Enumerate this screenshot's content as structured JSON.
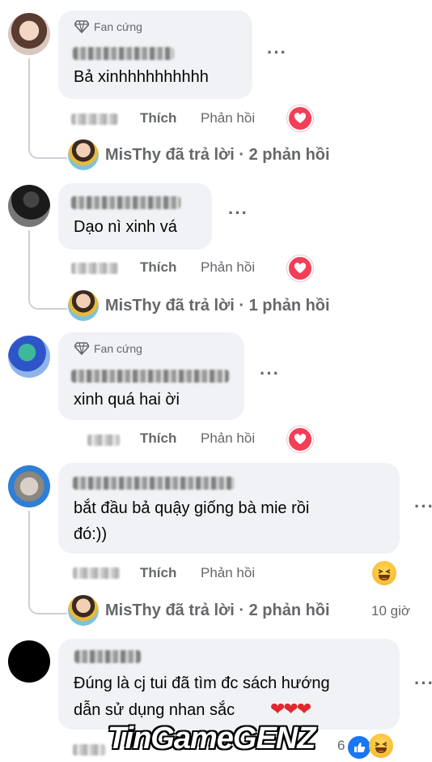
{
  "comments": [
    {
      "badge": "Fan cứng",
      "text": "Bả xinhhhhhhhhhh",
      "like": "Thích",
      "reply": "Phản hồi",
      "reaction": "heart",
      "reply_summary": "MisThy đã trả lời · 2 phản hồi"
    },
    {
      "text": "Dạo nì xinh vá",
      "like": "Thích",
      "reply": "Phản hồi",
      "reaction": "heart",
      "reply_summary": "MisThy đã trả lời · 1 phản hồi"
    },
    {
      "badge": "Fan cứng",
      "text": "xinh quá hai ời",
      "like": "Thích",
      "reply": "Phản hồi",
      "reaction": "heart"
    },
    {
      "text_line1": "bắt đầu bả quậy giống bà mie rồi",
      "text_line2": "đó:))",
      "like": "Thích",
      "reply": "Phản hồi",
      "reaction": "haha",
      "reply_summary": "MisThy đã trả lời · 2 phản hồi",
      "timestamp": "10 giờ"
    },
    {
      "text_line1": "Đúng là cj tui đã tìm đc sách hướng",
      "text_line2": "dẫn sử dụng nhan sắc",
      "hearts": "❤❤❤",
      "reaction_count": "6",
      "reaction": "like-haha"
    }
  ],
  "more_label": "···",
  "watermark": "TinGameGENZ",
  "colors": {
    "bubble": "#f0f2f5",
    "secondary_text": "#65676b",
    "heart": "#f33e58",
    "like": "#1877f2"
  },
  "icons": {
    "badge": "diamond-icon",
    "more": "more-icon",
    "heart": "heart-reaction-icon",
    "haha": "haha-reaction-icon",
    "like": "like-reaction-icon"
  }
}
